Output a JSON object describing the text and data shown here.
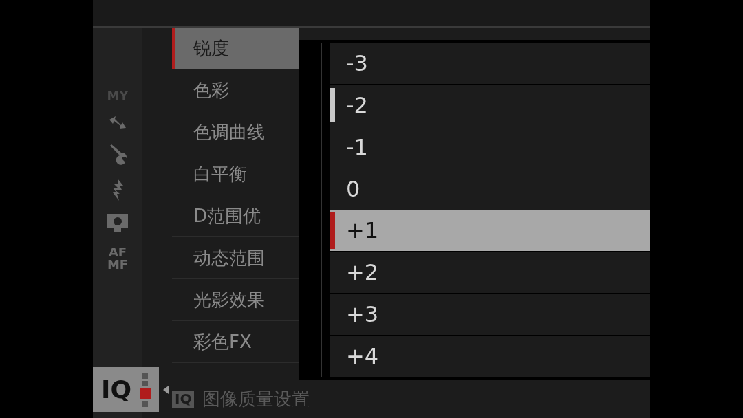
{
  "sidebar": {
    "tabs": [
      {
        "kind": "my",
        "label": "MY",
        "selected": false
      },
      {
        "kind": "arrow",
        "selected": false
      },
      {
        "kind": "wrench",
        "selected": false
      },
      {
        "kind": "flash",
        "selected": false
      },
      {
        "kind": "camera",
        "selected": false
      },
      {
        "kind": "afmf",
        "label": "AF",
        "label2": "MF",
        "selected": false
      },
      {
        "kind": "iq",
        "label": "IQ",
        "selected": true
      }
    ]
  },
  "menu": {
    "items": [
      {
        "label": "锐度",
        "selected": true
      },
      {
        "label": "色彩",
        "selected": false
      },
      {
        "label": "色调曲线",
        "selected": false
      },
      {
        "label": "白平衡",
        "selected": false
      },
      {
        "label": "D范围优",
        "selected": false
      },
      {
        "label": "动态范围",
        "selected": false
      },
      {
        "label": "光影效果",
        "selected": false
      },
      {
        "label": "彩色FX",
        "selected": false
      }
    ],
    "footer": {
      "icon_label": "IQ",
      "label": "图像质量设置"
    }
  },
  "popup": {
    "options": [
      {
        "label": "-3",
        "selected": false,
        "current": false
      },
      {
        "label": "-2",
        "selected": false,
        "current": true
      },
      {
        "label": "-1",
        "selected": false,
        "current": false
      },
      {
        "label": "0",
        "selected": false,
        "current": false
      },
      {
        "label": "+1",
        "selected": true,
        "current": false
      },
      {
        "label": "+2",
        "selected": false,
        "current": false
      },
      {
        "label": "+3",
        "selected": false,
        "current": false
      },
      {
        "label": "+4",
        "selected": false,
        "current": false
      }
    ]
  }
}
